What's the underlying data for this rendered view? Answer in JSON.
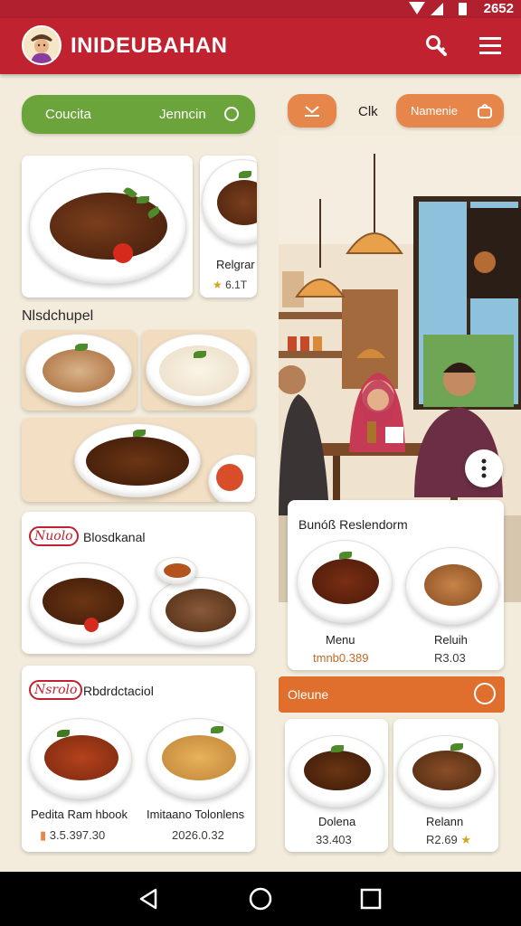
{
  "status_bar": {
    "time": "2652"
  },
  "app_bar": {
    "title": "INIDEUBAHAN",
    "icons": [
      "search-icon",
      "menu-icon"
    ]
  },
  "left": {
    "filter_pill": {
      "left_label": "Coucita",
      "right_label": "Jenncin"
    },
    "featured": [
      {
        "title": "",
        "price": ""
      },
      {
        "title": "Relgrar",
        "price": "6.1T"
      }
    ],
    "section_title": "Nlsdchupel",
    "card_one": {
      "brand": "Nuolo",
      "title": "Blosdkanal"
    },
    "card_two": {
      "brand": "Nsrolo",
      "title": "Rbdrdctaciol",
      "items": [
        {
          "name": "Pedita Ram hbook",
          "price": "3.5.397.30"
        },
        {
          "name": "Imitaano Tolonlens",
          "price": "2026.0.32"
        }
      ]
    }
  },
  "right": {
    "top_bar": {
      "mid_label": "Clk",
      "btn_label": "Namenie"
    },
    "menu_card": {
      "title": "Bunóß Reslendorm",
      "items": [
        {
          "name": "Menu",
          "price": "tmnb0.389"
        },
        {
          "name": "Reluih",
          "price": "R3.03"
        }
      ]
    },
    "orange_bar": {
      "label": "Oleune"
    },
    "bottom_cards": [
      {
        "name": "Dolena",
        "price": "33.403"
      },
      {
        "name": "Relann",
        "price": "R2.69"
      }
    ]
  },
  "colors": {
    "brand_red": "#c0222f",
    "accent_green": "#6aa43a",
    "accent_orange": "#e7864a"
  }
}
